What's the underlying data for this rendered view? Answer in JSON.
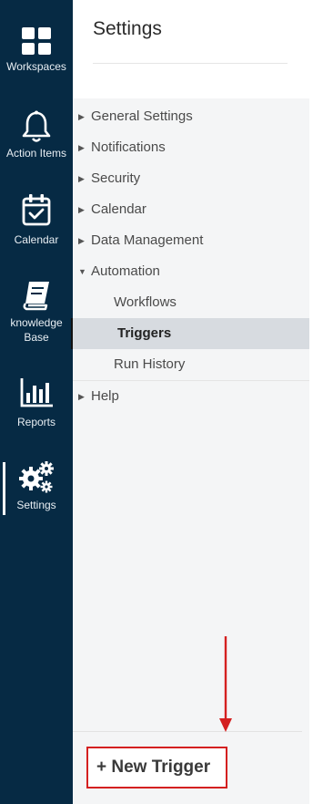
{
  "rail": {
    "items": [
      {
        "label": "Workspaces",
        "icon": "grid-icon"
      },
      {
        "label": "Action Items",
        "icon": "bell-icon"
      },
      {
        "label": "Calendar",
        "icon": "calendar-check-icon"
      },
      {
        "label_line1": "knowledge",
        "label_line2": "Base",
        "icon": "book-icon"
      },
      {
        "label": "Reports",
        "icon": "bar-chart-icon"
      },
      {
        "label": "Settings",
        "icon": "gears-icon"
      }
    ]
  },
  "settings": {
    "title": "Settings",
    "menu": [
      {
        "label": "General Settings",
        "caret": "▶"
      },
      {
        "label": "Notifications",
        "caret": "▶"
      },
      {
        "label": "Security",
        "caret": "▶"
      },
      {
        "label": "Calendar",
        "caret": "▶"
      },
      {
        "label": "Data Management",
        "caret": "▶"
      },
      {
        "label": "Automation",
        "caret": "▼"
      }
    ],
    "automation_children": [
      {
        "label": "Workflows"
      },
      {
        "label": "Triggers"
      },
      {
        "label": "Run History"
      }
    ],
    "help": {
      "label": "Help",
      "caret": "▶"
    },
    "new_trigger_label": "+ New Trigger"
  },
  "colors": {
    "rail_bg": "#062a44",
    "panel_bg": "#f4f5f6",
    "active_row_bg": "#d7dbe0",
    "highlight_red": "#d42020"
  }
}
